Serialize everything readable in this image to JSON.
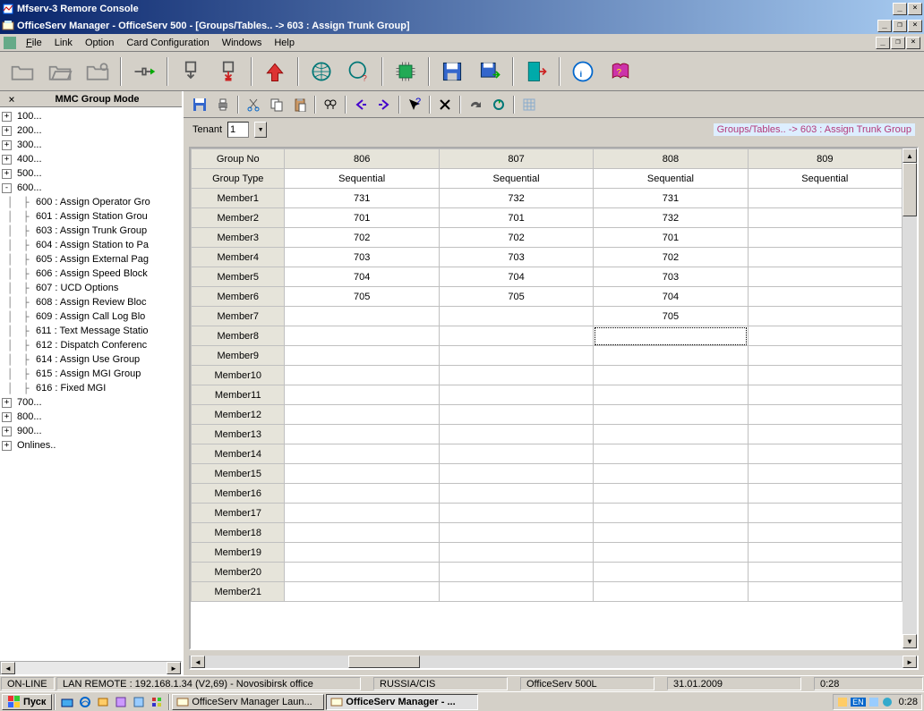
{
  "outer_title": "Mfserv-3 Remore Console",
  "inner_title": "OfficeServ Manager - OfficeServ 500 - [Groups/Tables.. -> 603 : Assign Trunk Group]",
  "menu": {
    "file": "File",
    "link": "Link",
    "option": "Option",
    "card": "Card Configuration",
    "windows": "Windows",
    "help": "Help"
  },
  "sidebar_title": "MMC Group Mode",
  "tree_top": [
    "100...",
    "200...",
    "300...",
    "400...",
    "500..."
  ],
  "tree_expanded_label": "600...",
  "tree_children": [
    "600 : Assign Operator Gro",
    "601 : Assign Station Grou",
    "603 : Assign Trunk Group",
    "604 : Assign Station to Pa",
    "605 : Assign External Pag",
    "606 : Assign Speed Block",
    "607 : UCD Options",
    "608 : Assign Review Bloc",
    "609 : Assign Call Log Blo",
    "611 : Text Message Statio",
    "612 : Dispatch Conferenc",
    "614 : Assign Use Group",
    "615 : Assign MGI Group",
    "616 : Fixed MGI"
  ],
  "tree_bottom": [
    "700...",
    "800...",
    "900...",
    "Onlines.."
  ],
  "tenant_label": "Tenant",
  "tenant_value": "1",
  "breadcrumb": "Groups/Tables.. -> 603 : Assign Trunk Group",
  "grid": {
    "corner": "Group No",
    "type_label": "Group Type",
    "columns": [
      "806",
      "807",
      "808",
      "809"
    ],
    "types": [
      "Sequential",
      "Sequential",
      "Sequential",
      "Sequential"
    ],
    "row_labels": [
      "Member1",
      "Member2",
      "Member3",
      "Member4",
      "Member5",
      "Member6",
      "Member7",
      "Member8",
      "Member9",
      "Member10",
      "Member11",
      "Member12",
      "Member13",
      "Member14",
      "Member15",
      "Member16",
      "Member17",
      "Member18",
      "Member19",
      "Member20",
      "Member21"
    ],
    "cells": [
      [
        "731",
        "732",
        "731",
        ""
      ],
      [
        "701",
        "701",
        "732",
        ""
      ],
      [
        "702",
        "702",
        "701",
        ""
      ],
      [
        "703",
        "703",
        "702",
        ""
      ],
      [
        "704",
        "704",
        "703",
        ""
      ],
      [
        "705",
        "705",
        "704",
        ""
      ],
      [
        "",
        "",
        "705",
        ""
      ],
      [
        "",
        "",
        "",
        ""
      ],
      [
        "",
        "",
        "",
        ""
      ],
      [
        "",
        "",
        "",
        ""
      ],
      [
        "",
        "",
        "",
        ""
      ],
      [
        "",
        "",
        "",
        ""
      ],
      [
        "",
        "",
        "",
        ""
      ],
      [
        "",
        "",
        "",
        ""
      ],
      [
        "",
        "",
        "",
        ""
      ],
      [
        "",
        "",
        "",
        ""
      ],
      [
        "",
        "",
        "",
        ""
      ],
      [
        "",
        "",
        "",
        ""
      ],
      [
        "",
        "",
        "",
        ""
      ],
      [
        "",
        "",
        "",
        ""
      ],
      [
        "",
        "",
        "",
        ""
      ]
    ],
    "focus": {
      "row": 7,
      "col": 2
    }
  },
  "status": {
    "online": "ON-LINE",
    "remote": "LAN REMOTE : 192.168.1.34 (V2,69) - Novosibirsk office",
    "region": "RUSSIA/CIS",
    "product": "OfficeServ 500L",
    "date": "31.01.2009",
    "time": "0:28"
  },
  "taskbar": {
    "start": "Пуск",
    "task1": "OfficeServ Manager Laun...",
    "task2": "OfficeServ Manager - ...",
    "lang": "EN",
    "clock": "0:28"
  }
}
